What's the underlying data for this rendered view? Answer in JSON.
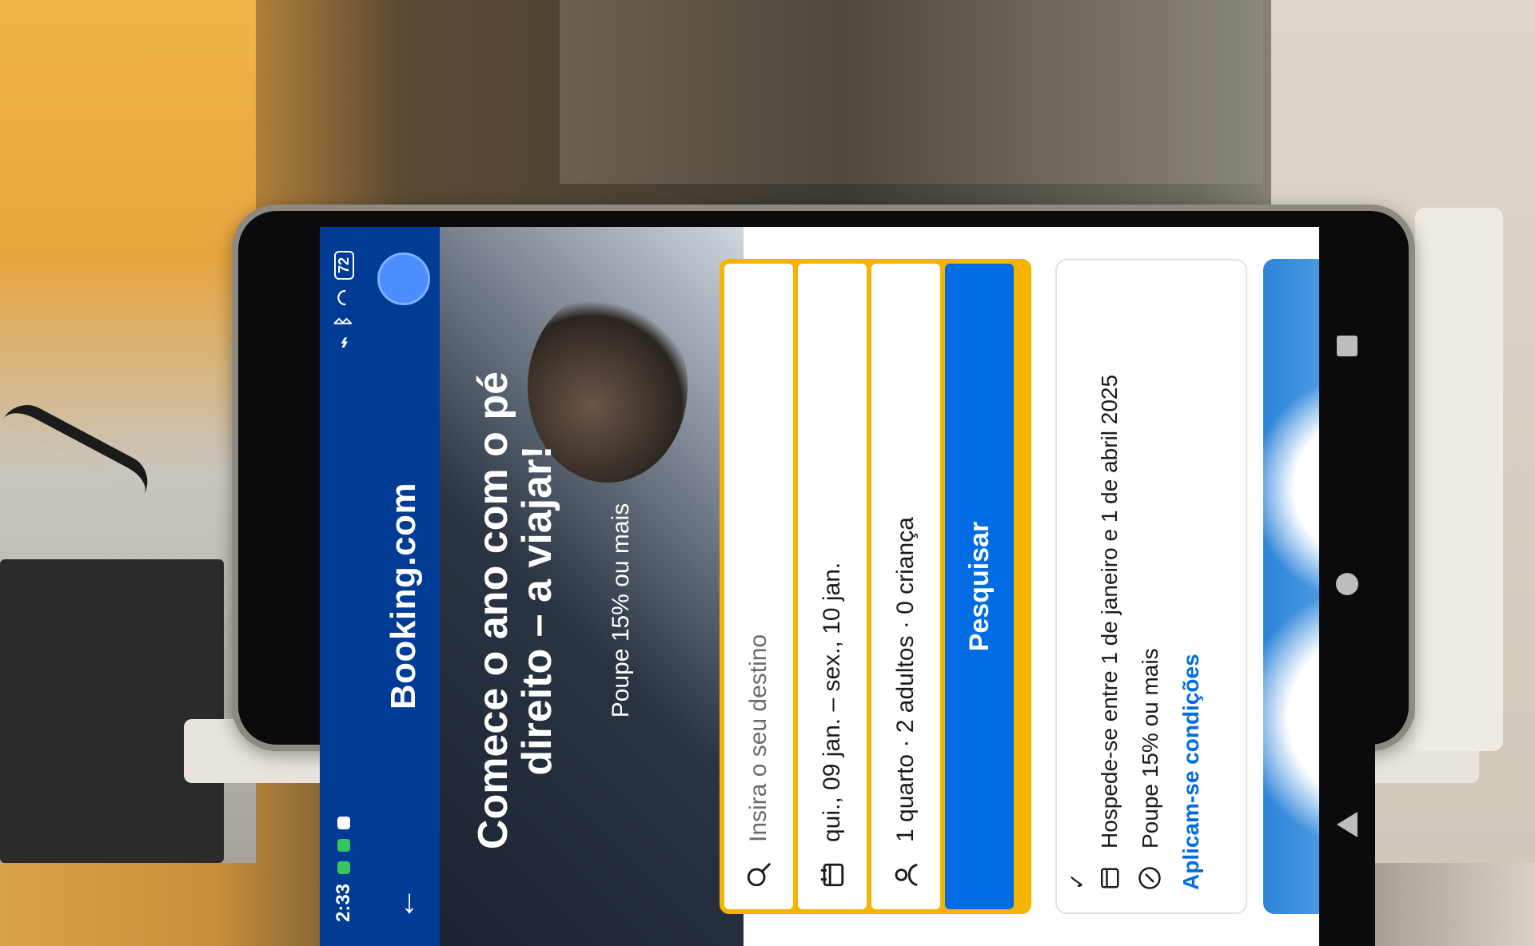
{
  "status_bar": {
    "time": "2:33",
    "battery": "72"
  },
  "app_bar": {
    "brand": "Booking.com"
  },
  "hero": {
    "title": "Comece o ano com o pé direito – a viajar!",
    "subtitle": "Poupe 15% ou mais"
  },
  "search": {
    "destination_placeholder": "Insira o seu destino",
    "dates": "qui., 09 jan. – sex., 10 jan.",
    "guests": "1 quarto · 2 adultos · 0 criança",
    "search_button": "Pesquisar"
  },
  "promo": {
    "check": "✓",
    "stay_window": "Hospede-se entre 1 de janeiro e 1 de abril 2025",
    "discount": "Poupe 15% ou mais",
    "conditions_link": "Aplicam-se condições"
  },
  "icons": {
    "back": "arrow-up-icon",
    "search": "magnifier-icon",
    "calendar": "calendar-icon",
    "person": "person-icon",
    "discount": "percent-icon"
  },
  "colors": {
    "brand_blue": "#003b95",
    "accent_yellow": "#f4b400",
    "button_blue": "#006ce4"
  }
}
